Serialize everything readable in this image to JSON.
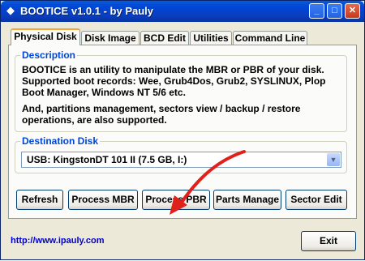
{
  "window": {
    "title": "BOOTICE v1.0.1 - by Pauly"
  },
  "titlebar_buttons": {
    "minimize": "_",
    "maximize": "□",
    "close": "✕"
  },
  "tabs": [
    {
      "label": "Physical Disk",
      "active": true
    },
    {
      "label": "Disk Image"
    },
    {
      "label": "BCD Edit"
    },
    {
      "label": "Utilities"
    },
    {
      "label": "Command Line"
    }
  ],
  "description": {
    "legend": "Description",
    "paragraph1": "BOOTICE is an utility to manipulate the MBR or PBR of your disk. Supported boot records: Wee, Grub4Dos, Grub2, SYSLINUX, Plop Boot Manager, Windows NT 5/6 etc.",
    "paragraph2": "And, partitions management, sectors view / backup / restore operations, are also supported."
  },
  "destination": {
    "legend": "Destination Disk",
    "selected": "USB: KingstonDT 101 II (7.5 GB, I:)"
  },
  "actions": {
    "refresh": "Refresh",
    "process_mbr": "Process MBR",
    "process_pbr": "Process PBR",
    "parts_manage": "Parts Manage",
    "sector_edit": "Sector Edit"
  },
  "footer": {
    "link": "http://www.ipauly.com",
    "exit": "Exit"
  },
  "colors": {
    "annotation_arrow": "#e0201a",
    "legend": "#0046d5",
    "title_bar": "#0046d5"
  }
}
